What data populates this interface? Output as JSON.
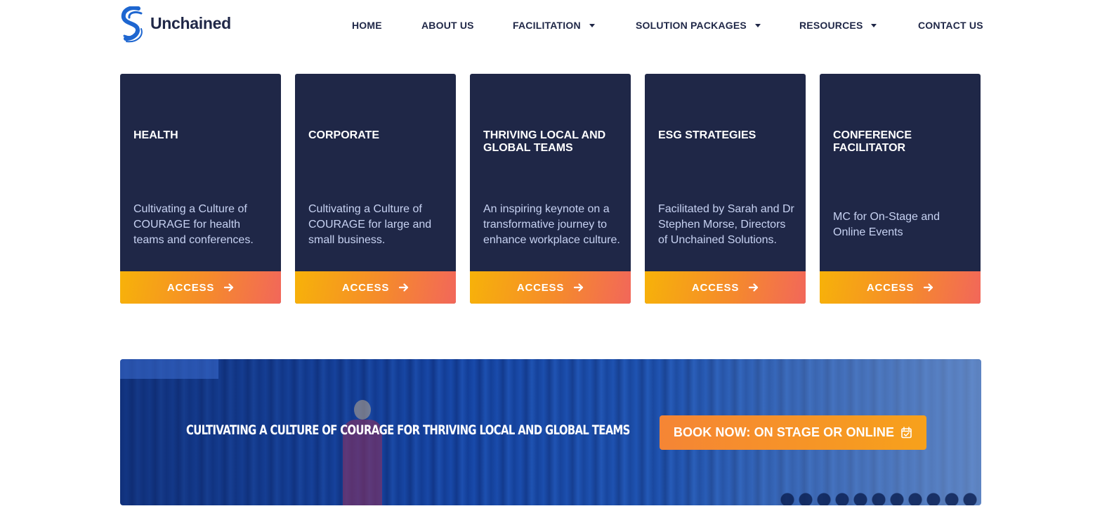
{
  "brand": {
    "name": "Unchained",
    "logo_icon": "unchained-s-logo-icon",
    "primary_color": "#1f2747",
    "accent_color": "#f58a2c"
  },
  "nav": {
    "items": [
      {
        "label": "HOME",
        "has_dropdown": false
      },
      {
        "label": "ABOUT US",
        "has_dropdown": false
      },
      {
        "label": "FACILITATION",
        "has_dropdown": true
      },
      {
        "label": "SOLUTION PACKAGES",
        "has_dropdown": true
      },
      {
        "label": "RESOURCES",
        "has_dropdown": true
      },
      {
        "label": "CONTACT US",
        "has_dropdown": false
      }
    ]
  },
  "cards": [
    {
      "title": "HEALTH",
      "description": "Cultivating a Culture of COURAGE for health teams and conferences.",
      "button_label": "ACCESS"
    },
    {
      "title": "CORPORATE",
      "description": "Cultivating a Culture of COURAGE for large and small business.",
      "button_label": "ACCESS"
    },
    {
      "title": "THRIVING LOCAL AND GLOBAL TEAMS",
      "description": "An inspiring keynote on a transformative journey to enhance workplace culture.",
      "button_label": "ACCESS"
    },
    {
      "title": "ESG STRATEGIES",
      "description": "Facilitated by  Sarah and Dr Stephen Morse, Directors of Unchained Solutions.",
      "button_label": "ACCESS"
    },
    {
      "title": "CONFERENCE FACILITATOR",
      "description": "MC for On-Stage and Online Events",
      "button_label": "ACCESS"
    }
  ],
  "banner": {
    "headline": "CULTIVATING A CULTURE OF COURAGE FOR THRIVING LOCAL AND GLOBAL TEAMS",
    "cta_label": "BOOK NOW: ON STAGE OR ONLINE",
    "cta_icon": "calendar-check-icon"
  }
}
